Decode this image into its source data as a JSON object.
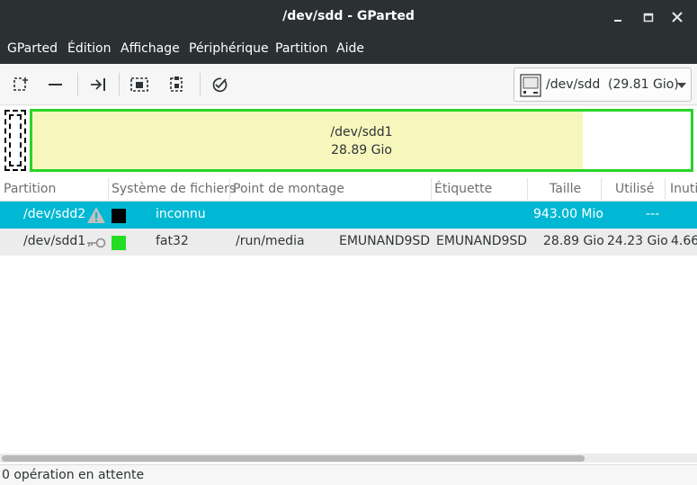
{
  "window": {
    "title": "/dev/sdd - GParted"
  },
  "menu": [
    "GParted",
    "Édition",
    "Affichage",
    "Périphérique",
    "Partition",
    "Aide"
  ],
  "toolbar": {
    "icons": [
      "new-partition-icon",
      "delete-partition-icon",
      "resize-move-icon",
      "copy-icon",
      "paste-icon",
      "apply-icon"
    ]
  },
  "device_selector": {
    "device": "/dev/sdd",
    "size": "(29.81 Gio)"
  },
  "disk_map": {
    "partition": {
      "name": "/dev/sdd1",
      "size": "28.89 Gio",
      "border_color": "#29d429",
      "used_color": "#f7f7bd",
      "used_fraction": 0.83
    }
  },
  "table": {
    "headers": {
      "partition": "Partition",
      "filesystem": "Système de fichiers",
      "mountpoint": "Point de montage",
      "label": "Étiquette",
      "size": "Taille",
      "used": "Utilisé",
      "unused": "Inuti"
    },
    "rows": [
      {
        "partition": "/dev/sdd2",
        "icon": "warning-icon",
        "fs_color": "#000000",
        "filesystem": "inconnu",
        "mountpoint": "",
        "mount_label": "",
        "label": "",
        "size": "943.00 Mio",
        "used": "---",
        "unused": ""
      },
      {
        "partition": "/dev/sdd1",
        "icon": "key-icon",
        "fs_color": "#22dd22",
        "filesystem": "fat32",
        "mountpoint": "/run/media",
        "mount_label": "EMUNAND9SD",
        "label": "EMUNAND9SD",
        "size": "28.89 Gio",
        "used": "24.23 Gio",
        "unused": "4.66"
      }
    ]
  },
  "status": {
    "text": "0 opération en attente"
  },
  "colors": {
    "selection": "#00b8d4",
    "headerbar": "#2b3033"
  }
}
